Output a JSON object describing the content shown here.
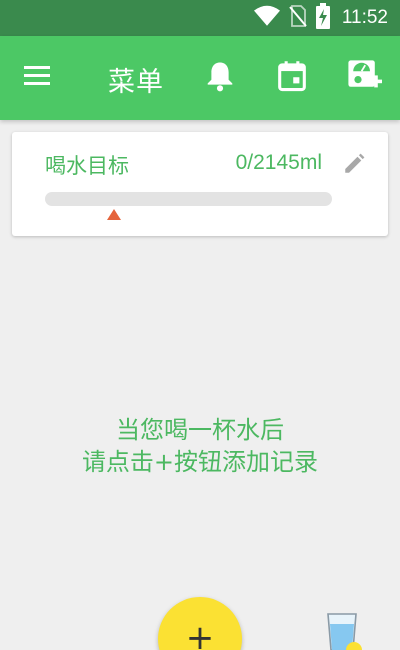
{
  "status_bar": {
    "time": "11:52",
    "icons": [
      "wifi-icon",
      "no-sim-icon",
      "battery-charging-icon"
    ]
  },
  "app_bar": {
    "title": "菜单",
    "icons": [
      "menu-icon",
      "bell-icon",
      "calendar-icon",
      "add-scale-icon"
    ]
  },
  "goal_card": {
    "label": "喝水目标",
    "value": "0/2145ml",
    "progress_fraction": 0,
    "icons": [
      "edit-pencil-icon"
    ]
  },
  "empty_state": {
    "line1": "当您喝一杯水后",
    "line2": "请点击+按钮添加记录"
  },
  "fab": {
    "label": "+"
  },
  "bottom_right": {
    "icon": "water-cup-icon"
  },
  "colors": {
    "primary": "#4cc865",
    "status_bar": "#3a8a4d",
    "accent_text": "#4cb861",
    "fab": "#fbe133",
    "marker": "#e5643c",
    "background": "#efefef"
  }
}
